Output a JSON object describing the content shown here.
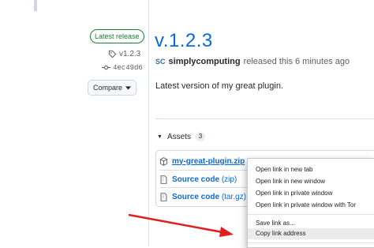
{
  "sidebar": {
    "badge": "Latest release",
    "tag": "v1.2.3",
    "commit": "4ec49d6",
    "compare_label": "Compare"
  },
  "release": {
    "title": "v.1.2.3",
    "avatar_initials": "SC",
    "author": "simplycomputing",
    "released_text": "released this 6 minutes ago",
    "body": "Latest version of my great plugin."
  },
  "assets": {
    "label": "Assets",
    "count": "3",
    "items": [
      {
        "name": "my-great-plugin.zip",
        "ext": ""
      },
      {
        "name": "Source code",
        "ext": "(zip)"
      },
      {
        "name": "Source code",
        "ext": "(tar.gz)"
      }
    ]
  },
  "context_menu": {
    "items": [
      "Open link in new tab",
      "Open link in new window",
      "Open link in private window",
      "Open link in private window with Tor",
      "Save link as...",
      "Copy link address"
    ]
  },
  "colors": {
    "accent_link": "#0969da",
    "badge_green": "#1a7f37",
    "arrow_red": "#e02020"
  },
  "icons": [
    "tag-icon",
    "commit-icon",
    "caret-down-icon",
    "package-icon",
    "file-zip-icon"
  ]
}
